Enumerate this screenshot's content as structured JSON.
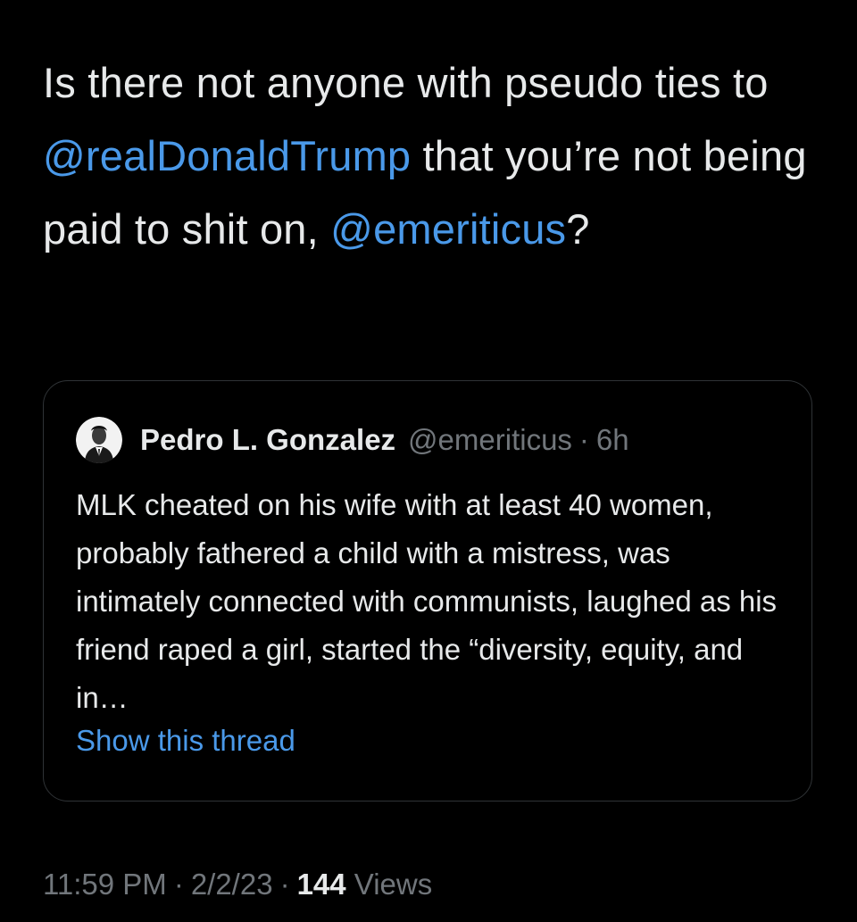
{
  "tweet": {
    "text_part1": "Is there not anyone with pseudo ties to ",
    "mention1": "@realDonaldTrump",
    "text_part2": " that you’re not being paid to shit on, ",
    "mention2": "@emeriticus",
    "text_part3": "?"
  },
  "quote": {
    "author_name": "Pedro L. Gonzalez",
    "author_handle": "@emeriticus",
    "separator": "·",
    "time": "6h",
    "body": "MLK cheated on his wife with at least 40 women, probably fathered a child with a mistress, was intimately connected with communists, laughed as his friend raped a girl, started the “diversity, equity, and in…",
    "show_thread": "Show this thread"
  },
  "meta": {
    "time": "11:59 PM",
    "separator": "·",
    "date": "2/2/23",
    "views_count": "144",
    "views_label": "Views"
  },
  "colors": {
    "background": "#000000",
    "text": "#e7e9ea",
    "link": "#4a99e9",
    "secondary": "#71767b",
    "border": "#2f3336"
  }
}
